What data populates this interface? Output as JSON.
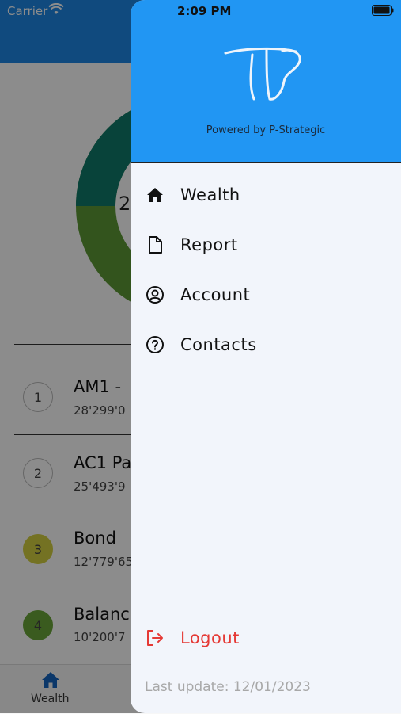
{
  "status_bar": {
    "carrier": "Carrier",
    "time": "2:09 PM"
  },
  "background": {
    "donut_center_text": "2",
    "rows": [
      {
        "number": "1",
        "title": "AM1 -",
        "subtitle": "28'299'0",
        "circle_color": "#ffffff"
      },
      {
        "number": "2",
        "title": "AC1 Pa",
        "subtitle": "25'493'9",
        "circle_color": "#ffffff"
      },
      {
        "number": "3",
        "title": "Bond",
        "subtitle": "12'779'65",
        "circle_color": "#d4d040"
      },
      {
        "number": "4",
        "title": "Balanc",
        "subtitle": "10'200'7",
        "circle_color": "#6aa63a"
      }
    ],
    "bottom_tab": {
      "label": "Wealth",
      "icon": "home-icon"
    }
  },
  "drawer": {
    "powered_by": "Powered by P-Strategic",
    "menu": [
      {
        "label": "Wealth",
        "icon": "home-icon"
      },
      {
        "label": "Report",
        "icon": "document-icon"
      },
      {
        "label": "Account",
        "icon": "user-circle-icon"
      },
      {
        "label": "Contacts",
        "icon": "help-circle-icon"
      }
    ],
    "logout_label": "Logout",
    "last_update": "Last update: 12/01/2023"
  },
  "colors": {
    "header_blue": "#2196f3",
    "logout_red": "#e53935",
    "donut_green": "#5e9a36",
    "donut_teal": "#0f7a6a"
  }
}
